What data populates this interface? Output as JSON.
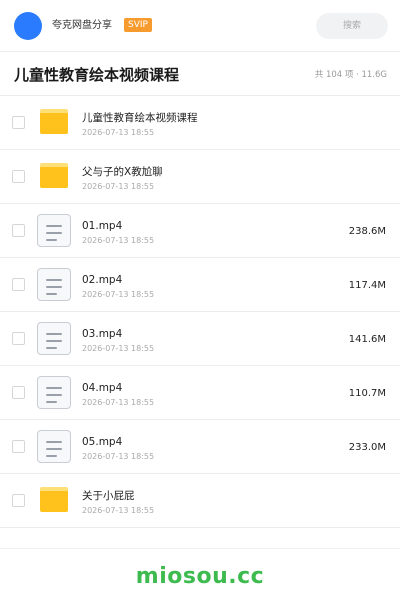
{
  "header": {
    "share_name": "夸克网盘分享",
    "badge": "SVIP",
    "search_placeholder": "搜索"
  },
  "folder": {
    "title": "儿童性教育绘本视频课程",
    "summary": "共 104 项 · 11.6G"
  },
  "items": [
    {
      "type": "folder",
      "name": "儿童性教育绘本视频课程",
      "date": "2026-07-13 18:55",
      "size": ""
    },
    {
      "type": "folder",
      "name": "父与子的X教尬聊",
      "date": "2026-07-13 18:55",
      "size": ""
    },
    {
      "type": "file",
      "name": "01.mp4",
      "date": "2026-07-13 18:55",
      "size": "238.6M"
    },
    {
      "type": "file",
      "name": "02.mp4",
      "date": "2026-07-13 18:55",
      "size": "117.4M"
    },
    {
      "type": "file",
      "name": "03.mp4",
      "date": "2026-07-13 18:55",
      "size": "141.6M"
    },
    {
      "type": "file",
      "name": "04.mp4",
      "date": "2026-07-13 18:55",
      "size": "110.7M"
    },
    {
      "type": "file",
      "name": "05.mp4",
      "date": "2026-07-13 18:55",
      "size": "233.0M"
    },
    {
      "type": "folder",
      "name": "关于小屁屁",
      "date": "2026-07-13 18:55",
      "size": ""
    }
  ],
  "icons": {
    "folder": "folder-icon",
    "file": "file-icon",
    "avatar_color": "#2b7bff",
    "folder_color": "#ffc21c",
    "badge_color": "#f79b2f"
  },
  "footer": {
    "watermark": "miosou.cc",
    "watermark_color": "#3dbb4e"
  }
}
